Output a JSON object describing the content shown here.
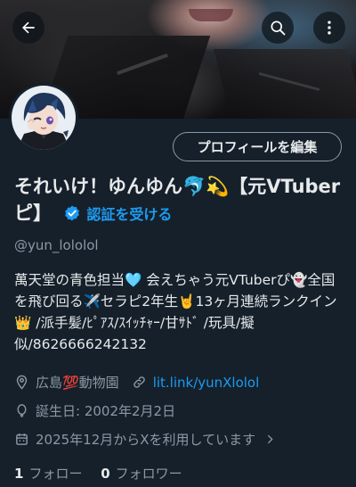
{
  "header": {
    "back_icon": "arrow-left-icon",
    "search_icon": "search-icon",
    "more_icon": "more-vertical-icon"
  },
  "profile": {
    "edit_button": "プロフィールを編集",
    "name": "それいけ！ゆんゆん🐬💫【元VTuberピ】",
    "verify_label": "認証を受ける",
    "handle": "@yun_lololol",
    "bio": "萬天堂の青色担当🩵 会えちゃう元VTuberぴ👻全国を飛び回る✈️セラピ2年生🤘13ヶ月連続ランクイン 👑 /派手髪/ﾋﾟｱｽ/ｽｲｯﾁｬｰ/甘ｻﾄﾞ /玩具/擬似/8626666242132",
    "location": "広島💯動物園",
    "link": "lit.link/yunXlolol",
    "birthday": "誕生日: 2002年2月2日",
    "joined": "2025年12月からXを利用しています",
    "following_count": "1",
    "following_label": "フォロー",
    "followers_count": "0",
    "followers_label": "フォロワー"
  },
  "colors": {
    "background": "#15202b",
    "accent": "#1d9bf0",
    "muted": "#8b98a5",
    "text": "#e7e9ea"
  }
}
